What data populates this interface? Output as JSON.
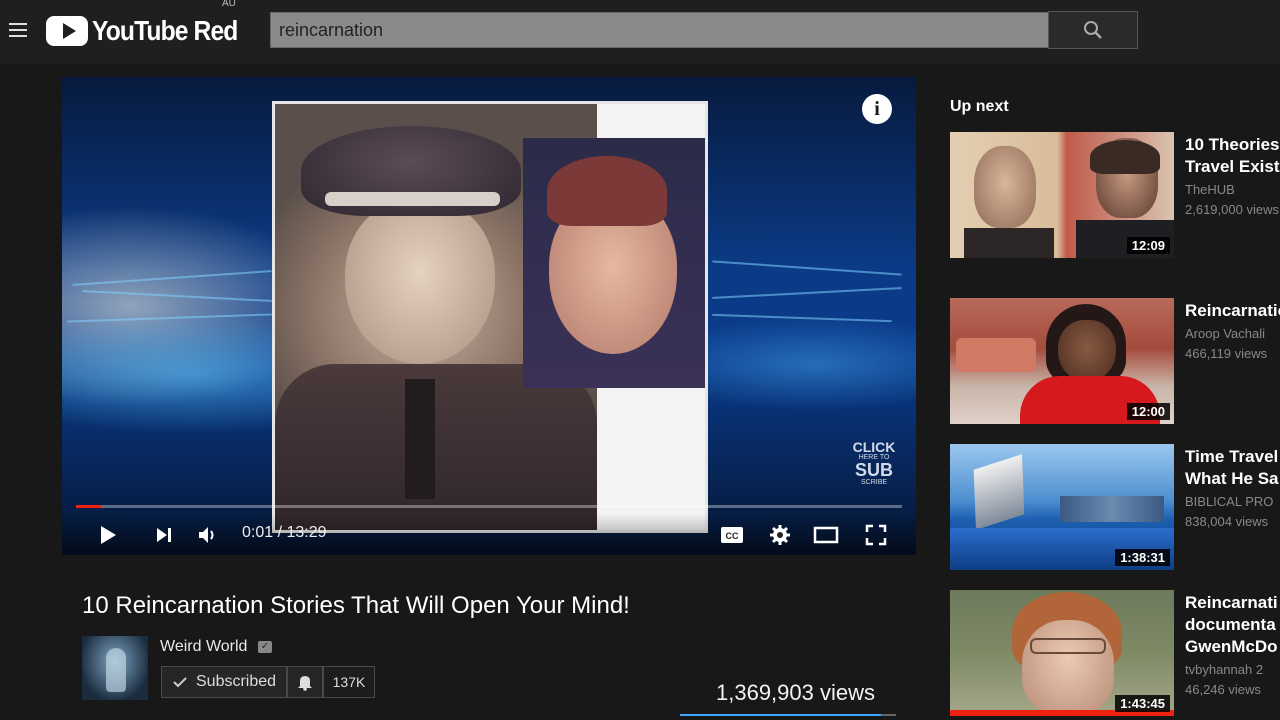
{
  "header": {
    "logo_text": "YouTube Red",
    "region": "AU",
    "search_value": "reincarnation",
    "search_placeholder": "Search"
  },
  "player": {
    "time_current": "0:01",
    "time_separator": "/",
    "time_total": "13:29",
    "progress_fraction": 0.03,
    "watermark": {
      "line1": "CLICK",
      "line2": "HERE TO",
      "line3": "SUB",
      "line4": "SCRIBE"
    },
    "icons": [
      "info-icon",
      "play-icon",
      "next-icon",
      "volume-icon",
      "captions-icon",
      "settings-icon",
      "theater-icon",
      "fullscreen-icon"
    ]
  },
  "video": {
    "title": "10 Reincarnation Stories That Will Open Your Mind!",
    "channel": "Weird World",
    "subscribe_label": "Subscribed",
    "subscriber_count": "137K",
    "views": "1,369,903 views",
    "like_fraction": 0.93
  },
  "sidebar": {
    "heading": "Up next",
    "items": [
      {
        "title_line1": "10 Theories",
        "title_line2": "Travel Exist",
        "channel": "TheHUB",
        "views": "2,619,000 views",
        "duration": "12:09"
      },
      {
        "title_line1": "Reincarnatio",
        "title_line2": "",
        "channel": "Aroop Vachali",
        "views": "466,119 views",
        "duration": "12:00"
      },
      {
        "title_line1": "Time Travel",
        "title_line2": "What He Sa",
        "channel": "BIBLICAL PRO",
        "views": "838,004 views",
        "duration": "1:38:31"
      },
      {
        "title_line1": "Reincarnati",
        "title_line2": "documenta",
        "title_line3": "GwenMcDo",
        "channel": "tvbyhannah 2",
        "views": "46,246 views",
        "duration": "1:43:45"
      }
    ]
  },
  "colors": {
    "background": "#181818",
    "masthead": "#1f1f1f",
    "progress": "#ee2211",
    "like_bar": "#3ea6ff"
  }
}
